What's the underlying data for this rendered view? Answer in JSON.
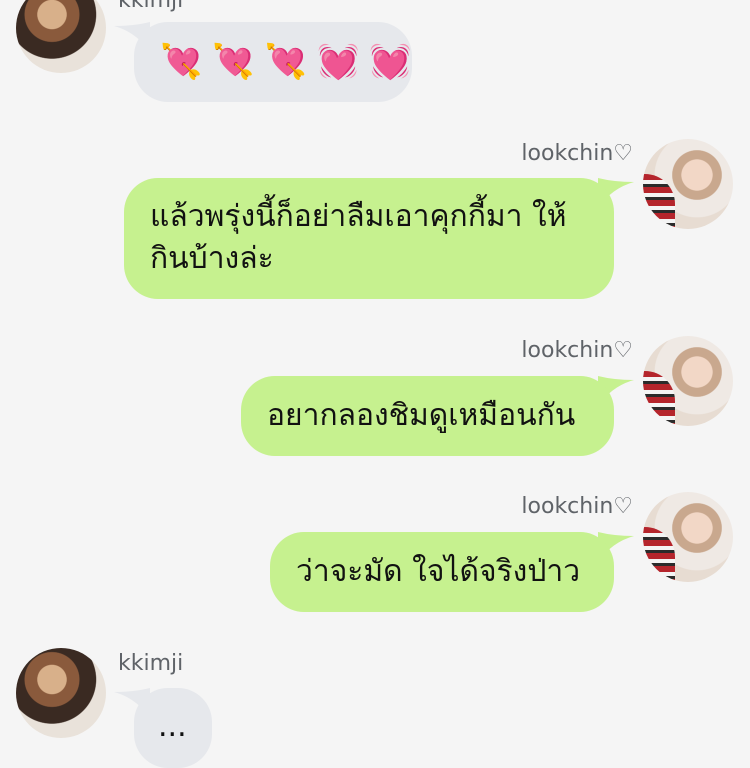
{
  "messages": [
    {
      "sender": "kkimji",
      "side": "left",
      "text": "",
      "emojis": [
        "💘",
        "💘",
        "💘",
        "💓",
        "💓"
      ]
    },
    {
      "sender": "lookchin♡",
      "side": "right",
      "lines": [
        "แล้วพรุ่งนี้ก็อย่าลืมเอาคุกกี้มา ให้",
        "กินบ้างล่ะ"
      ]
    },
    {
      "sender": "lookchin♡",
      "side": "right",
      "text": "อยากลองชิมดูเหมือนกัน"
    },
    {
      "sender": "lookchin♡",
      "side": "right",
      "text": "ว่าจะมัด ใจได้จริงป่าว"
    },
    {
      "sender": "kkimji",
      "side": "left",
      "text": "..."
    }
  ],
  "colors": {
    "incoming": "#e6e8ec",
    "outgoing": "#c6f18f",
    "background": "#f5f5f5"
  }
}
